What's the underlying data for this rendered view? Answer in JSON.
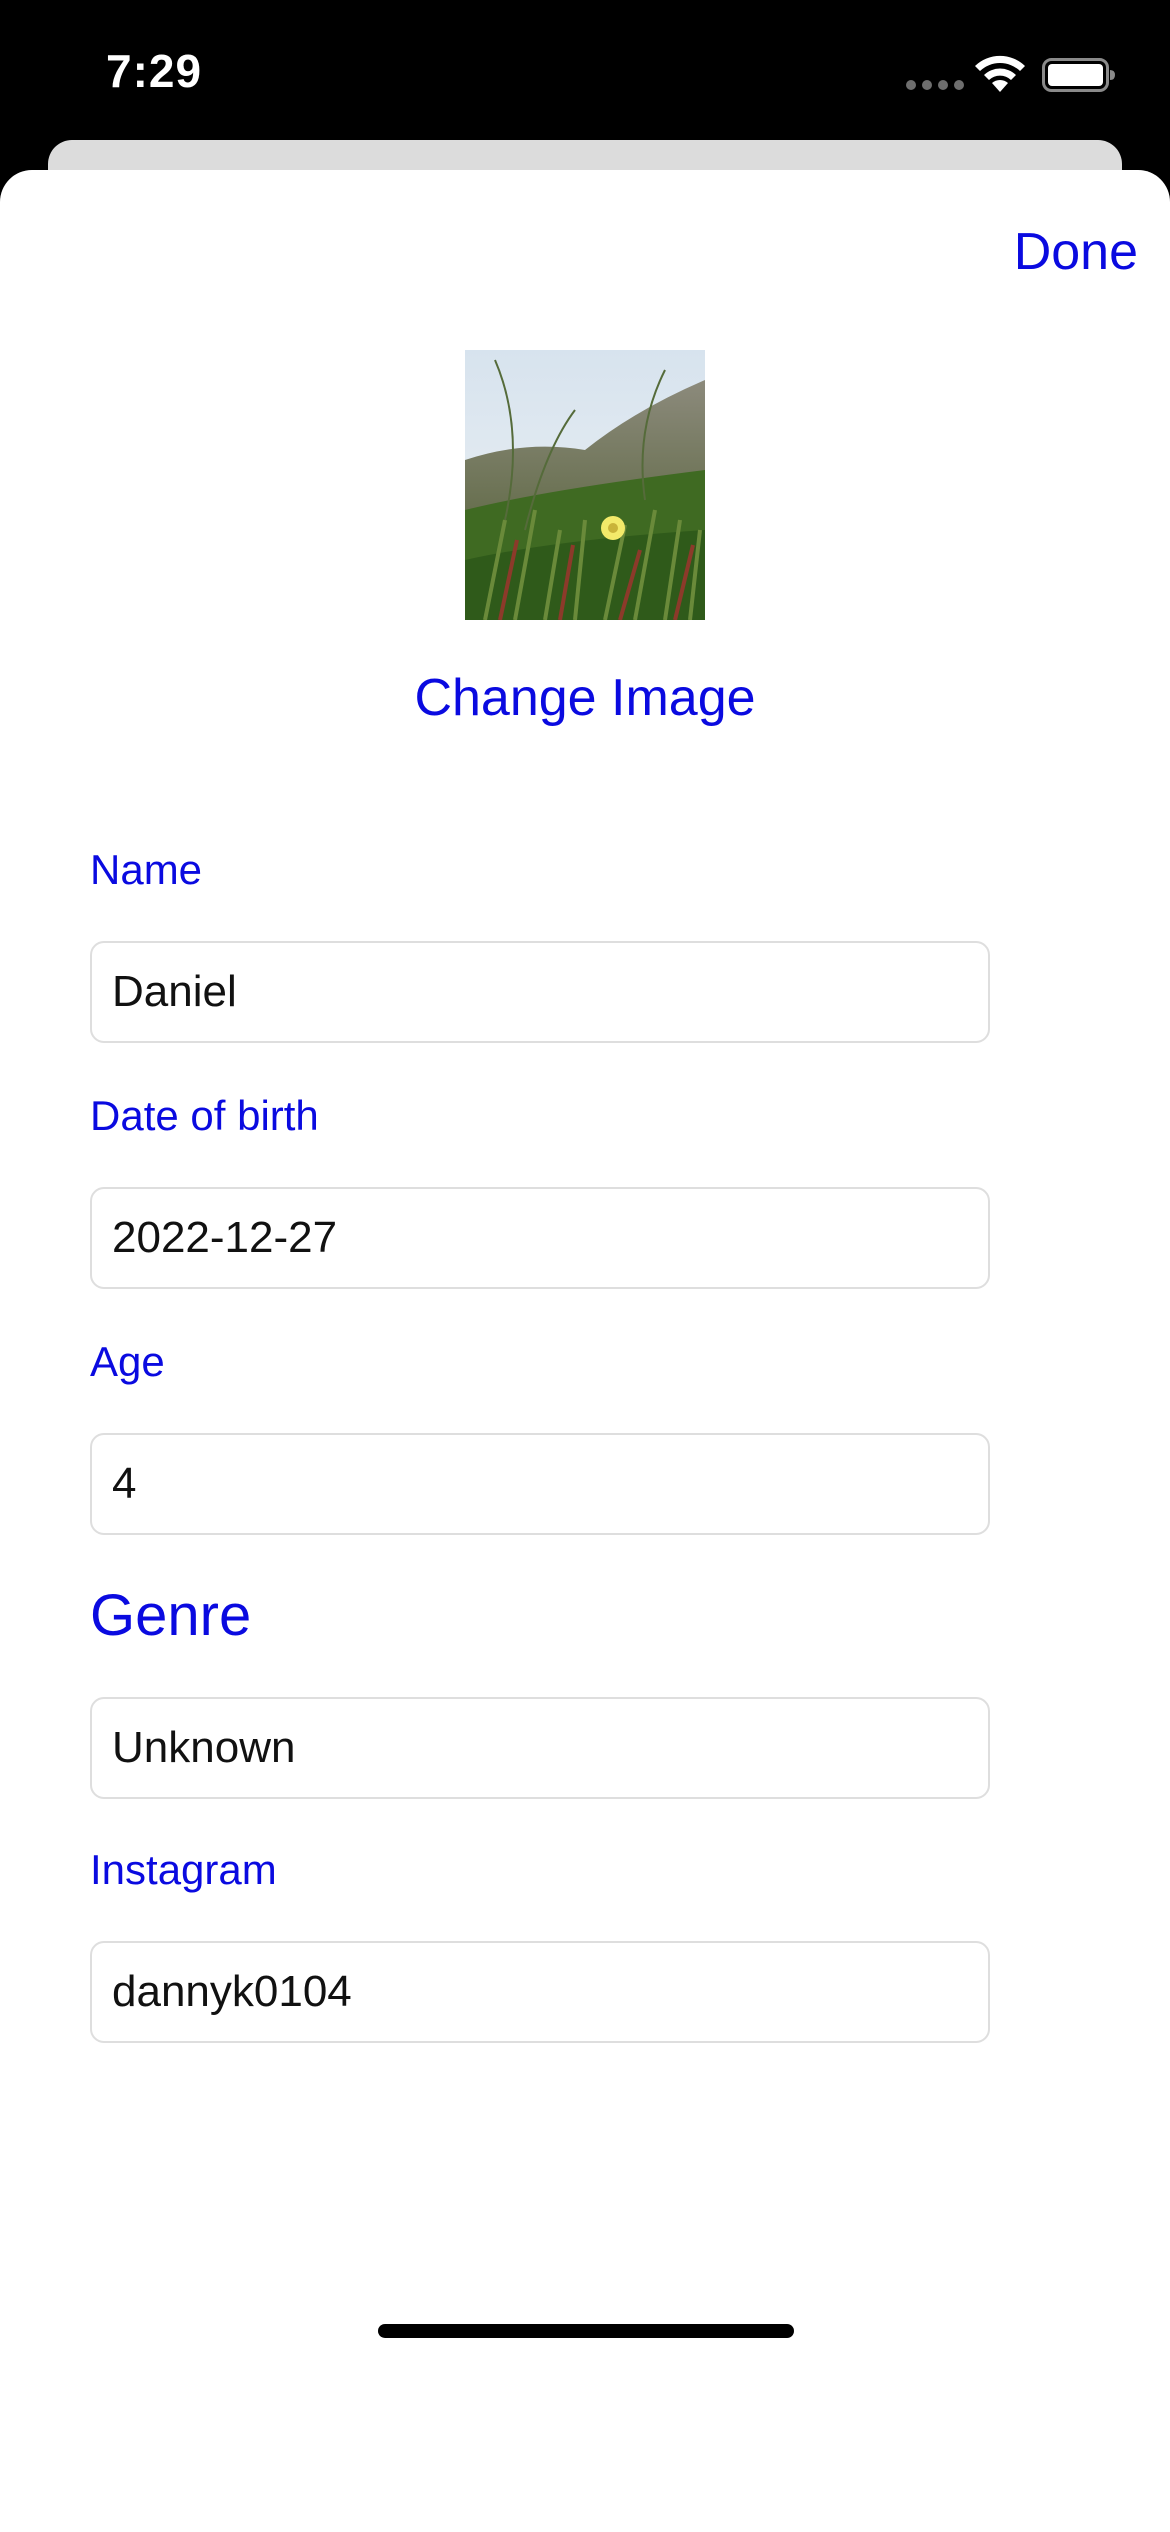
{
  "status_bar": {
    "time": "7:29"
  },
  "header": {
    "done_label": "Done"
  },
  "profile": {
    "photo_description": "flower-photo",
    "change_image_label": "Change Image"
  },
  "form": {
    "name": {
      "label": "Name",
      "value": "Daniel"
    },
    "date_of_birth": {
      "label": "Date of birth",
      "value": "2022-12-27"
    },
    "age": {
      "label": "Age",
      "value": "4"
    },
    "genre": {
      "label": "Genre",
      "value": "Unknown"
    },
    "instagram": {
      "label": "Instagram",
      "value": "dannyk0104"
    }
  },
  "colors": {
    "accent": "#0a0ae0",
    "field_border": "#dedede",
    "background": "#ffffff"
  }
}
